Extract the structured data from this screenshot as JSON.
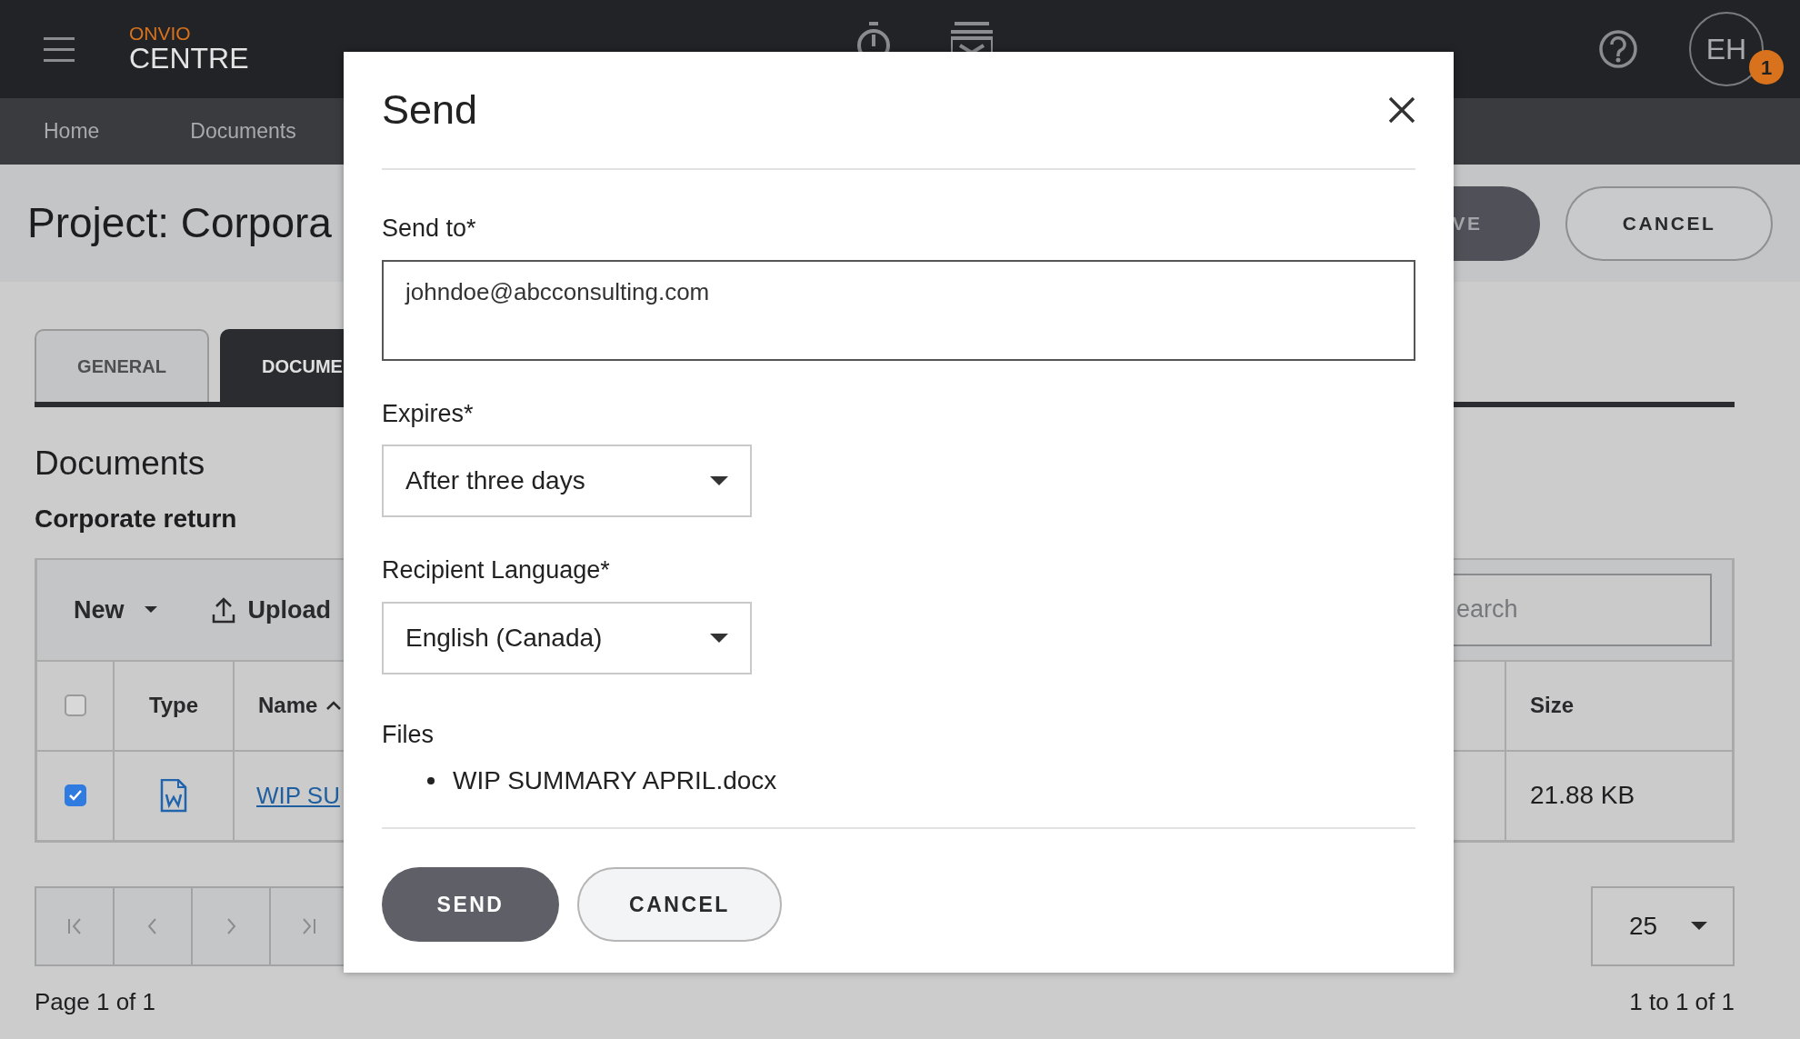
{
  "topbar": {
    "brand_top": "ONVIO",
    "brand": "CENTRE",
    "avatar": "EH",
    "notification_count": "1"
  },
  "nav": [
    {
      "label": "Home"
    },
    {
      "label": "Documents"
    }
  ],
  "page": {
    "title": "Project: Corpora",
    "primary_button": "VE",
    "cancel_button": "CANCEL"
  },
  "tabs": [
    {
      "label": "GENERAL",
      "selected": false
    },
    {
      "label": "DOCUME",
      "selected": true
    }
  ],
  "section_title": "Documents",
  "subsection_title": "Corporate return",
  "toolbar": {
    "new": "New",
    "upload": "Upload",
    "search_placeholder": "earch"
  },
  "table": {
    "header_checked": false,
    "columns": [
      "Type",
      "Name",
      "Size"
    ],
    "rows": [
      {
        "checked": true,
        "name": "WIP SU",
        "size": "21.88 KB"
      }
    ]
  },
  "pagination": {
    "page_label": "Page 1 of 1",
    "page_size": "25",
    "range": "1 to 1 of 1"
  },
  "dialog": {
    "title": "Send",
    "fields": [
      {
        "kind": "textarea",
        "label": "Send to*",
        "value": "johndoe@abcconsulting.com"
      },
      {
        "kind": "select",
        "label": "Expires*",
        "value": "After three days"
      },
      {
        "kind": "select",
        "label": "Recipient Language*",
        "value": "English (Canada)"
      }
    ],
    "files_label": "Files",
    "files": [
      "WIP SUMMARY APRIL.docx"
    ],
    "buttons": [
      {
        "label": "SEND",
        "kind": "primary"
      },
      {
        "label": "CANCEL",
        "kind": "secondary"
      }
    ]
  }
}
